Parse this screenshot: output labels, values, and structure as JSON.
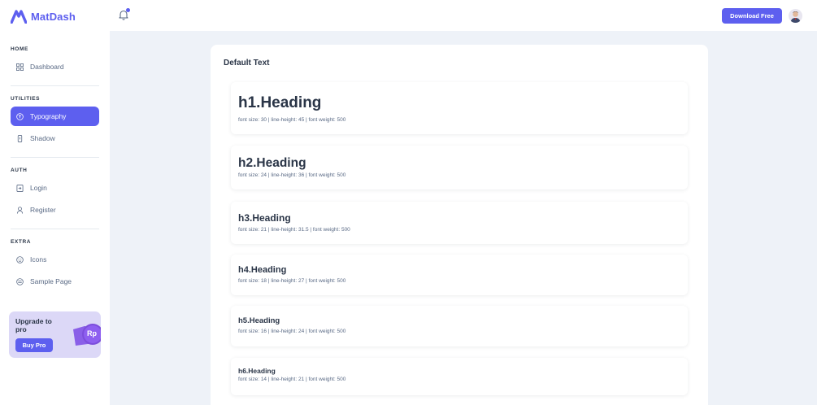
{
  "brand": {
    "name": "MatDash"
  },
  "header": {
    "download_label": "Download Free"
  },
  "sidebar": {
    "sections": [
      {
        "title": "HOME",
        "items": [
          {
            "label": "Dashboard",
            "icon": "dashboard-icon"
          }
        ]
      },
      {
        "title": "UTILITIES",
        "items": [
          {
            "label": "Typography",
            "icon": "typography-icon",
            "active": true
          },
          {
            "label": "Shadow",
            "icon": "shadow-icon"
          }
        ]
      },
      {
        "title": "AUTH",
        "items": [
          {
            "label": "Login",
            "icon": "login-icon"
          },
          {
            "label": "Register",
            "icon": "register-icon"
          }
        ]
      },
      {
        "title": "EXTRA",
        "items": [
          {
            "label": "Icons",
            "icon": "icons-icon"
          },
          {
            "label": "Sample Page",
            "icon": "sample-page-icon"
          }
        ]
      }
    ],
    "promo": {
      "title": "Upgrade to pro",
      "button": "Buy Pro",
      "badge": "Rp"
    }
  },
  "main": {
    "card_title": "Default Text",
    "headings": [
      {
        "label": "h1.Heading",
        "meta": "font size: 30 | line-height: 45 | font weight: 500"
      },
      {
        "label": "h2.Heading",
        "meta": "font size: 24 | line-height: 36 | font weight: 500"
      },
      {
        "label": "h3.Heading",
        "meta": "font size: 21 | line-height: 31.5 | font weight: 500"
      },
      {
        "label": "h4.Heading",
        "meta": "font size: 18 | line-height: 27 | font weight: 500"
      },
      {
        "label": "h5.Heading",
        "meta": "font size: 16 | line-height: 24 | font weight: 500"
      },
      {
        "label": "h6.Heading",
        "meta": "font size: 14 | line-height: 21 | font weight: 500"
      }
    ]
  },
  "colors": {
    "primary": "#5d5fef",
    "text": "#2a3547",
    "muted": "#5a6a85",
    "background": "#eef2f8",
    "promo_bg": "#dcd8f7"
  }
}
